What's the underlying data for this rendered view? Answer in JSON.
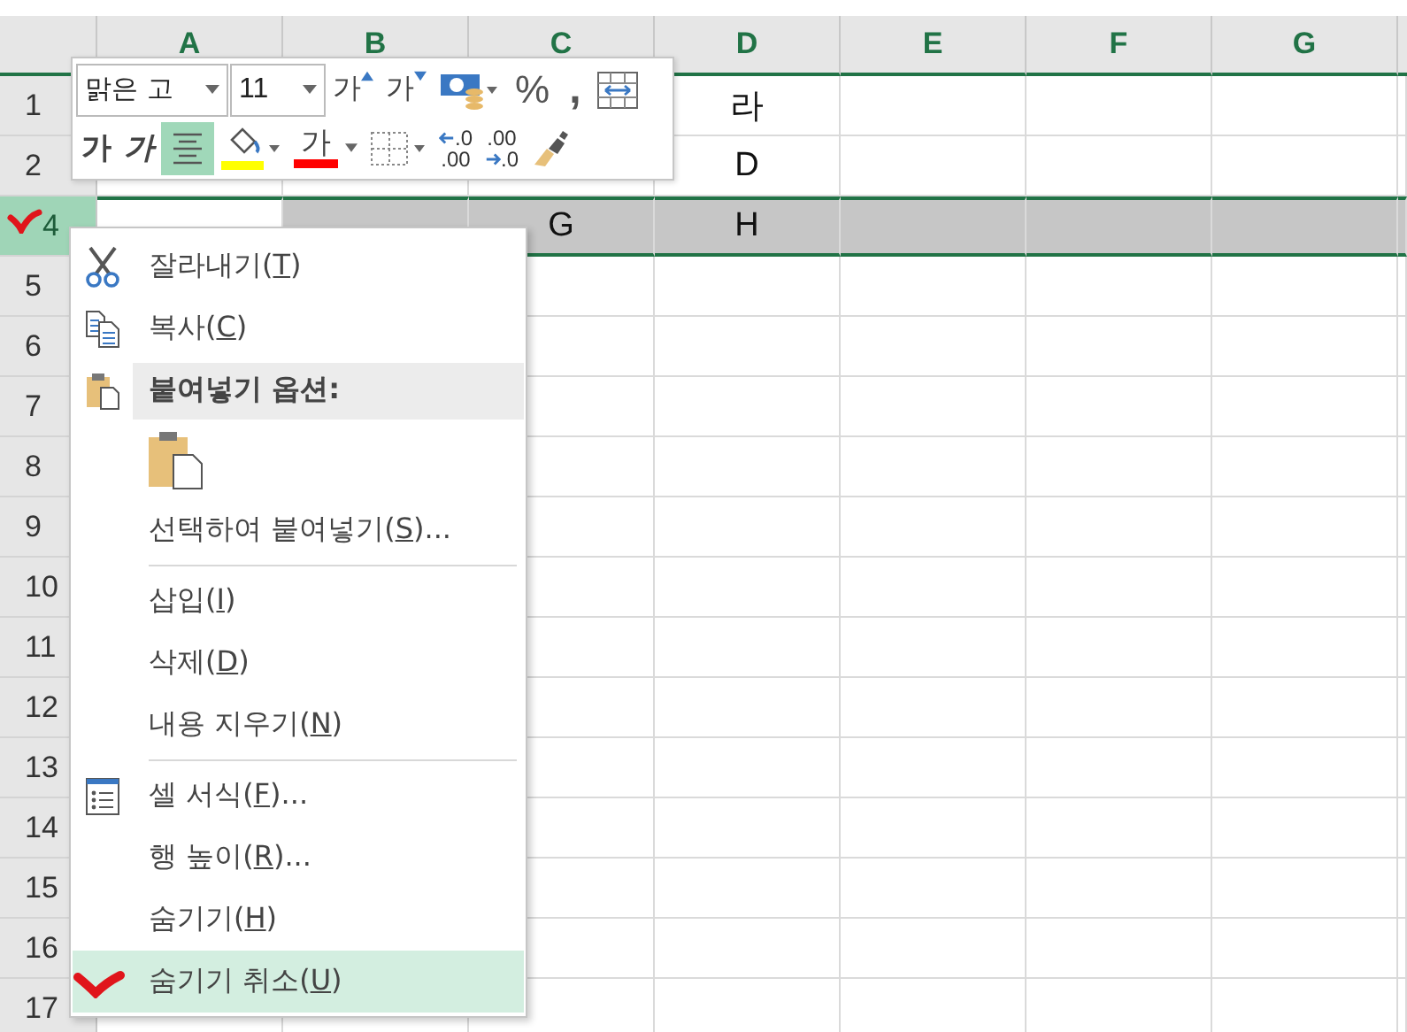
{
  "columns": [
    {
      "label": "A",
      "selected": true
    },
    {
      "label": "B",
      "selected": true
    },
    {
      "label": "C",
      "selected": true
    },
    {
      "label": "D",
      "selected": true
    },
    {
      "label": "E",
      "selected": true
    },
    {
      "label": "F",
      "selected": true
    },
    {
      "label": "G",
      "selected": true
    }
  ],
  "rows": [
    {
      "header": "1",
      "selected": false,
      "marked": false,
      "cells": [
        {},
        {},
        {},
        {
          "text": "라"
        },
        {},
        {},
        {}
      ]
    },
    {
      "header": "2",
      "selected": false,
      "marked": false,
      "cells": [
        {},
        {},
        {},
        {
          "text": "D"
        },
        {},
        {},
        {}
      ]
    },
    {
      "header": "4",
      "selected": true,
      "marked": true,
      "cells": [
        {
          "active": true
        },
        {
          "active": false
        },
        {
          "text": "G",
          "active": false
        },
        {
          "text": "H",
          "active": false
        },
        {
          "active": false
        },
        {
          "active": false
        },
        {
          "active": false
        }
      ]
    },
    {
      "header": "5",
      "selected": false,
      "marked": false,
      "cells": [
        {},
        {},
        {},
        {},
        {},
        {},
        {}
      ]
    },
    {
      "header": "6",
      "selected": false,
      "marked": false,
      "cells": [
        {},
        {},
        {},
        {},
        {},
        {},
        {}
      ]
    },
    {
      "header": "7",
      "selected": false,
      "marked": false,
      "cells": [
        {},
        {},
        {},
        {},
        {},
        {},
        {}
      ]
    },
    {
      "header": "8",
      "selected": false,
      "marked": false,
      "cells": [
        {},
        {},
        {},
        {},
        {},
        {},
        {}
      ]
    },
    {
      "header": "9",
      "selected": false,
      "marked": false,
      "cells": [
        {},
        {},
        {},
        {},
        {},
        {},
        {}
      ]
    },
    {
      "header": "10",
      "selected": false,
      "marked": false,
      "cells": [
        {},
        {},
        {},
        {},
        {},
        {},
        {}
      ]
    },
    {
      "header": "11",
      "selected": false,
      "marked": false,
      "cells": [
        {},
        {},
        {},
        {},
        {},
        {},
        {}
      ]
    },
    {
      "header": "12",
      "selected": false,
      "marked": false,
      "cells": [
        {},
        {},
        {},
        {},
        {},
        {},
        {}
      ]
    },
    {
      "header": "13",
      "selected": false,
      "marked": false,
      "cells": [
        {},
        {},
        {},
        {},
        {},
        {},
        {}
      ]
    },
    {
      "header": "14",
      "selected": false,
      "marked": false,
      "cells": [
        {},
        {},
        {},
        {},
        {},
        {},
        {}
      ]
    },
    {
      "header": "15",
      "selected": false,
      "marked": false,
      "cells": [
        {},
        {},
        {},
        {},
        {},
        {},
        {}
      ]
    },
    {
      "header": "16",
      "selected": false,
      "marked": false,
      "cells": [
        {},
        {},
        {},
        {},
        {},
        {},
        {}
      ]
    },
    {
      "header": "17",
      "selected": false,
      "marked": false,
      "cells": [
        {},
        {},
        {},
        {},
        {},
        {},
        {}
      ]
    }
  ],
  "mini_toolbar": {
    "font": "맑은 고",
    "size": "11",
    "row_1": [
      {
        "kind": "grow-font",
        "label": "가",
        "selected": false
      },
      {
        "kind": "shrink-font",
        "label": "가",
        "selected": false
      },
      {
        "kind": "accounting",
        "selected": false
      },
      {
        "kind": "percent",
        "label": "%",
        "selected": false
      },
      {
        "kind": "comma",
        "label": ",",
        "selected": false
      },
      {
        "kind": "merge",
        "selected": false
      }
    ],
    "row_2": [
      {
        "kind": "bold",
        "label": "가",
        "selected": false
      },
      {
        "kind": "italic",
        "label": "가",
        "selected": false
      },
      {
        "kind": "center",
        "selected": true
      },
      {
        "kind": "fill-color",
        "color": "#ffff00",
        "selected": false
      },
      {
        "kind": "font-color",
        "label": "가",
        "color": "#ff0000",
        "selected": false
      },
      {
        "kind": "borders",
        "selected": false
      },
      {
        "kind": "decrease-decimal",
        "top": ".0",
        "bottom": ".00",
        "selected": false
      },
      {
        "kind": "increase-decimal",
        "top": ".00",
        "bottom": ".0",
        "selected": false
      },
      {
        "kind": "format-painter",
        "selected": false
      }
    ]
  },
  "context_menu": {
    "items": [
      {
        "kind": "item",
        "before": "잘라내기(",
        "key": "T",
        "after": ")",
        "selected": false,
        "marked": false
      },
      {
        "kind": "item",
        "before": "복사(",
        "key": "C",
        "after": ")",
        "selected": false,
        "marked": false
      },
      {
        "kind": "header",
        "label": "붙여넣기 옵션:"
      },
      {
        "kind": "paste-options"
      },
      {
        "kind": "item",
        "before": "선택하여 붙여넣기(",
        "key": "S",
        "after": ")...",
        "selected": false,
        "marked": false
      },
      {
        "kind": "separator"
      },
      {
        "kind": "item",
        "before": "삽입(",
        "key": "I",
        "after": ")",
        "selected": false,
        "marked": false
      },
      {
        "kind": "item",
        "before": "삭제(",
        "key": "D",
        "after": ")",
        "selected": false,
        "marked": false
      },
      {
        "kind": "item",
        "before": "내용 지우기(",
        "key": "N",
        "after": ")",
        "selected": false,
        "marked": false
      },
      {
        "kind": "separator"
      },
      {
        "kind": "item",
        "before": "셀 서식(",
        "key": "F",
        "after": ")...",
        "selected": false,
        "marked": false
      },
      {
        "kind": "item",
        "before": "행 높이(",
        "key": "R",
        "after": ")...",
        "selected": false,
        "marked": false
      },
      {
        "kind": "item",
        "before": "숨기기(",
        "key": "H",
        "after": ")",
        "selected": false,
        "marked": false
      },
      {
        "kind": "item",
        "before": "숨기기 취소(",
        "key": "U",
        "after": ")",
        "selected": true,
        "marked": true
      }
    ]
  }
}
